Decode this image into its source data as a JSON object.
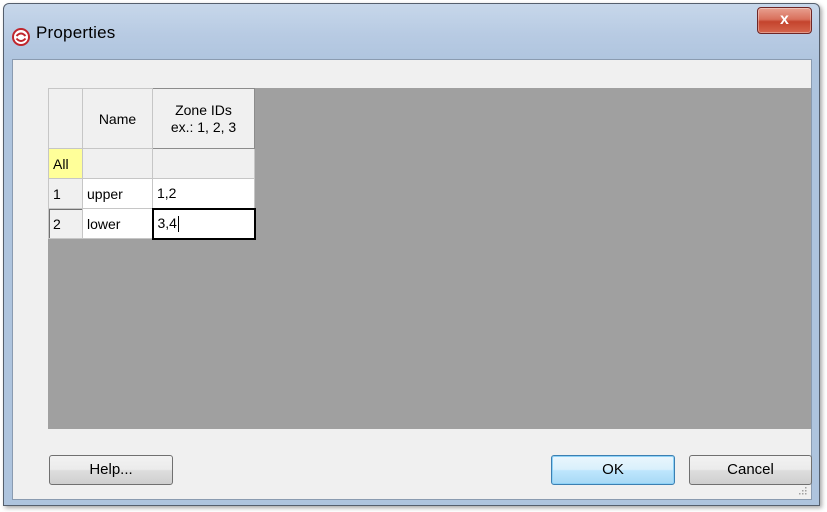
{
  "window": {
    "title": "Properties",
    "close_glyph": "x"
  },
  "grid": {
    "headers": {
      "name": "Name",
      "zone_line1": "Zone IDs",
      "zone_line2": "ex.: 1, 2, 3"
    },
    "all_label": "All",
    "rows": [
      {
        "index": "1",
        "name": "upper",
        "zone_ids": "1,2"
      },
      {
        "index": "2",
        "name": "lower",
        "zone_ids": "3,4"
      }
    ]
  },
  "buttons": {
    "help": "Help...",
    "ok": "OK",
    "cancel": "Cancel"
  },
  "icons": {
    "app": "red-circle-logo-icon",
    "close": "close-icon",
    "resize": "resize-grip-icon"
  },
  "colors": {
    "grid_background": "#a0a0a0",
    "all_row_header": "#ffff99",
    "close_button": "#c4442d",
    "default_button_border": "#3c7fb1"
  }
}
